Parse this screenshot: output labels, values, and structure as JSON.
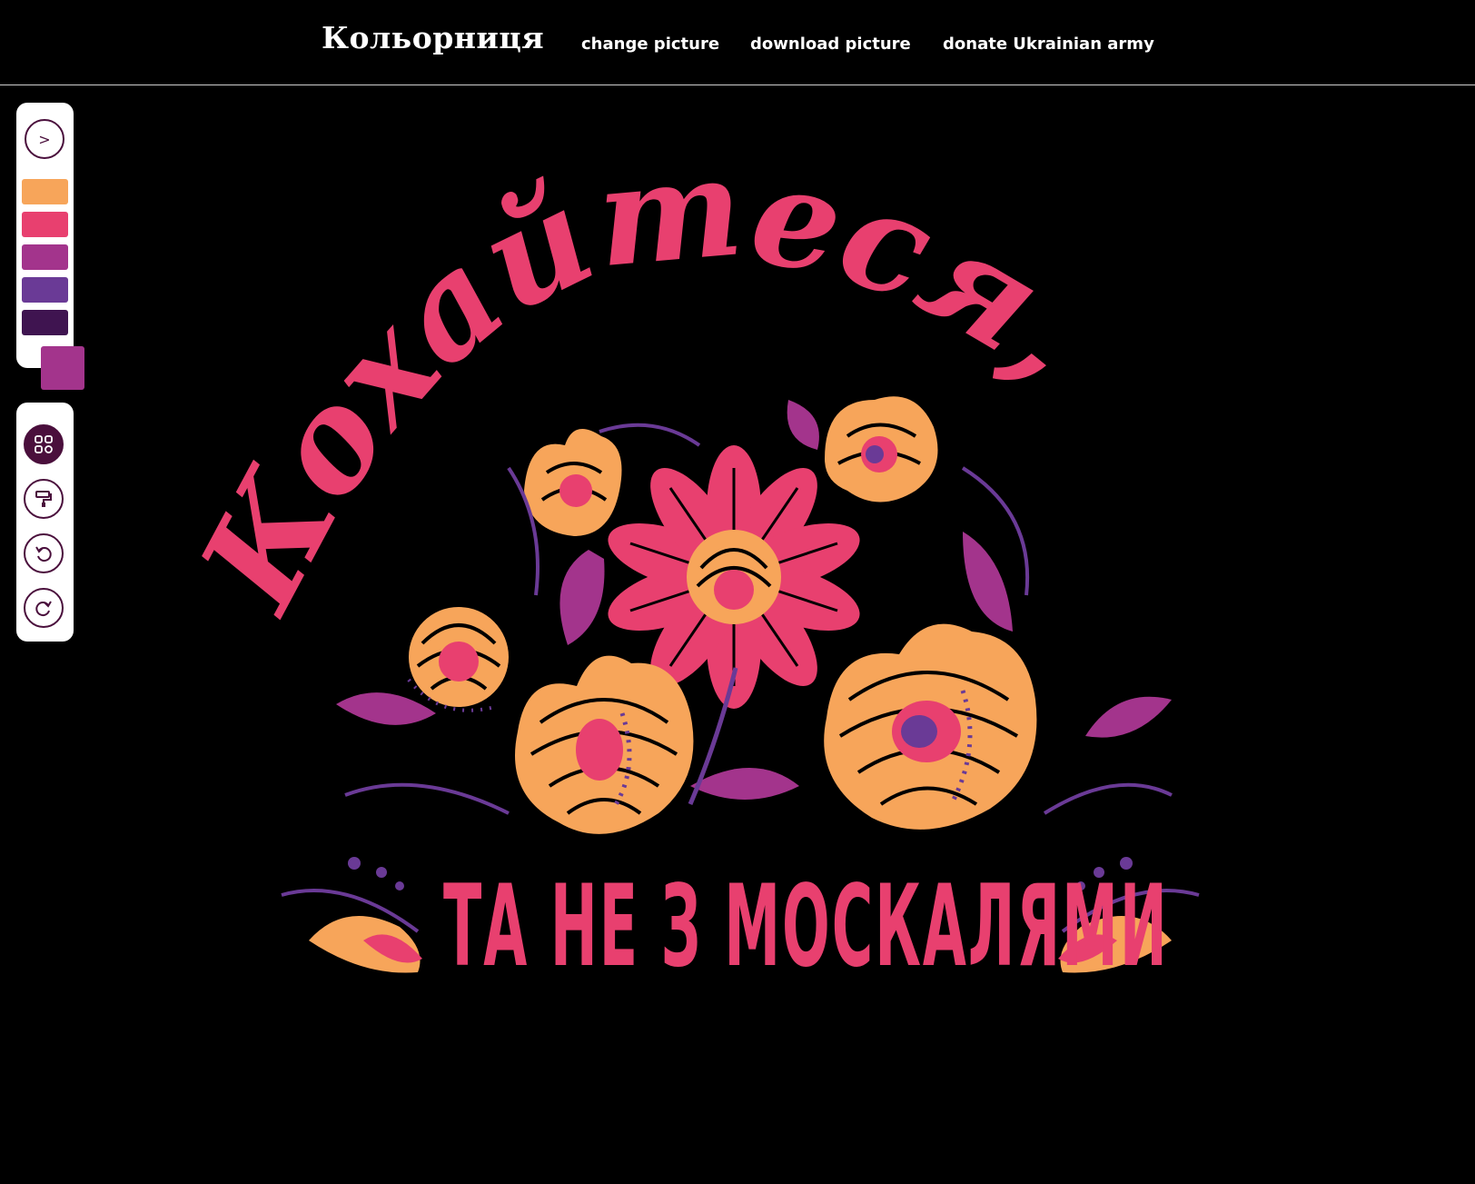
{
  "header": {
    "brand": "Кольорниця",
    "nav": [
      {
        "label": "change picture"
      },
      {
        "label": "download picture"
      },
      {
        "label": "donate Ukrainian army"
      }
    ]
  },
  "palette": {
    "toggle_label": ">",
    "swatches": [
      "#f7a55a",
      "#e8406f",
      "#a3348c",
      "#6a3a96",
      "#3f1450"
    ],
    "current_color": "#a3348c"
  },
  "tools": {
    "items": [
      {
        "icon": "color-picker-icon",
        "active": true
      },
      {
        "icon": "paint-roller-icon",
        "active": false
      },
      {
        "icon": "undo-icon",
        "active": false
      },
      {
        "icon": "redo-icon",
        "active": false
      }
    ]
  },
  "picture": {
    "headline": "Кохайтеся,",
    "subline": "ТА НЕ З МОСКАЛЯМИ",
    "colors": {
      "orange": "#f7a55a",
      "pink": "#e8406f",
      "magenta": "#a3348c",
      "purple": "#6a3a96"
    }
  }
}
